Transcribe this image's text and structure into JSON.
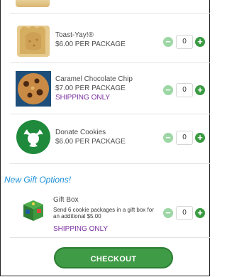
{
  "products": [
    {
      "name": "Toast-Yay!®",
      "price": "$6.00 PER PACKAGE",
      "quantity": "0",
      "note": ""
    },
    {
      "name": "Caramel Chocolate Chip",
      "price": "$7.00 PER PACKAGE",
      "quantity": "0",
      "note": "SHIPPING ONLY"
    },
    {
      "name": "Donate Cookies",
      "price": "$6.00 PER PACKAGE",
      "quantity": "0",
      "note": ""
    }
  ],
  "gift_section": {
    "title": "New Gift Options!",
    "item": {
      "name": "Gift Box",
      "description": "Send 6 cookie packages in a gift box for an additional $5.00",
      "quantity": "0",
      "note": "SHIPPING ONLY"
    }
  },
  "checkout_label": "CHECKOUT",
  "icons": {
    "minus": "minus-circle-icon",
    "plus": "plus-circle-icon"
  },
  "colors": {
    "accent_green": "#3a9b42",
    "light_green": "#9cd6a4",
    "link_blue": "#1e8fd6",
    "shipping_purple": "#7a2fa0"
  }
}
